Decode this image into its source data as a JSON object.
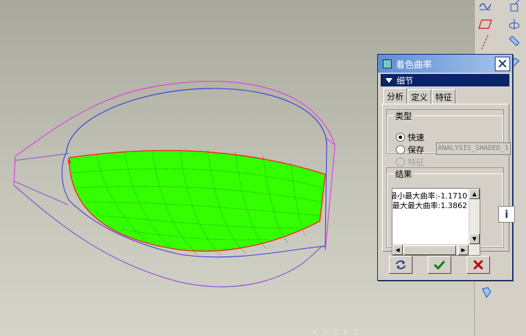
{
  "dialog": {
    "title": "着色曲率",
    "section_label": "细节",
    "tabs": [
      {
        "label": "分析",
        "active": true
      },
      {
        "label": "定义",
        "active": false
      },
      {
        "label": "特征",
        "active": false
      }
    ],
    "type_group": {
      "legend": "类型",
      "options": [
        {
          "label": "快速",
          "selected": true,
          "enabled": true
        },
        {
          "label": "保存",
          "selected": false,
          "enabled": true
        },
        {
          "label": "特征",
          "selected": false,
          "enabled": false
        }
      ],
      "name_value": "ANALYSIS_SHADED_1"
    },
    "results_group": {
      "legend": "结果",
      "lines": [
        "最小最大曲率:-1.1710",
        "最大最大曲率:1.3862"
      ]
    },
    "icons": {
      "title": "shaded-curvature-icon",
      "close": "close-icon",
      "info": "info-icon",
      "repaint": "repaint-icon",
      "ok": "checkmark-icon",
      "cancel": "cancel-x-icon"
    }
  },
  "viewport": {
    "coordinate_readout": "X Y Z 0 1"
  },
  "colors": {
    "surface_fill": "#33ff00",
    "surface_edge": "#ff2020",
    "curve_magenta": "#e040e0",
    "curve_blue": "#3a3ae0",
    "title_gradient_start": "#5d8fd6",
    "section_bar": "#0a246a",
    "ok_green": "#008000",
    "cancel_red": "#c00000"
  }
}
